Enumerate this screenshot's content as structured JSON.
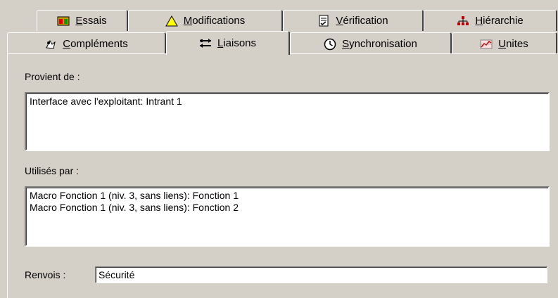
{
  "tabs_top": [
    {
      "label_key": "E",
      "label_rest": "ssais",
      "icon": "test-icon"
    },
    {
      "label_key": "M",
      "label_rest": "odifications",
      "icon": "warning-icon"
    },
    {
      "label_key": "V",
      "label_rest": "érification",
      "icon": "checklist-icon"
    },
    {
      "label_key": "H",
      "label_rest": "iérarchie",
      "icon": "hierarchy-icon"
    }
  ],
  "tabs_bottom": [
    {
      "label_key": "C",
      "label_rest": "ompléments",
      "icon": "complements-icon"
    },
    {
      "label_key": "L",
      "label_rest": "iaisons",
      "icon": "links-icon",
      "active": true
    },
    {
      "label_key": "S",
      "label_rest": "ynchronisation",
      "icon": "clock-icon"
    },
    {
      "label_key": "U",
      "label_rest": "nites",
      "icon": "units-icon"
    }
  ],
  "provient": {
    "label": "Provient de :",
    "items": [
      "Interface avec l'exploitant: Intrant 1"
    ]
  },
  "utilises": {
    "label": "Utilisés par :",
    "items": [
      "Macro Fonction 1 (niv. 3, sans liens): Fonction 1",
      "Macro Fonction 1 (niv. 3, sans liens): Fonction 2"
    ]
  },
  "renvois": {
    "label": "Renvois :",
    "value": "Sécurité"
  },
  "colors": {
    "face": "#d4d0c8",
    "highlight": "#ffffff",
    "shadow": "#808080",
    "dark_shadow": "#404040"
  }
}
